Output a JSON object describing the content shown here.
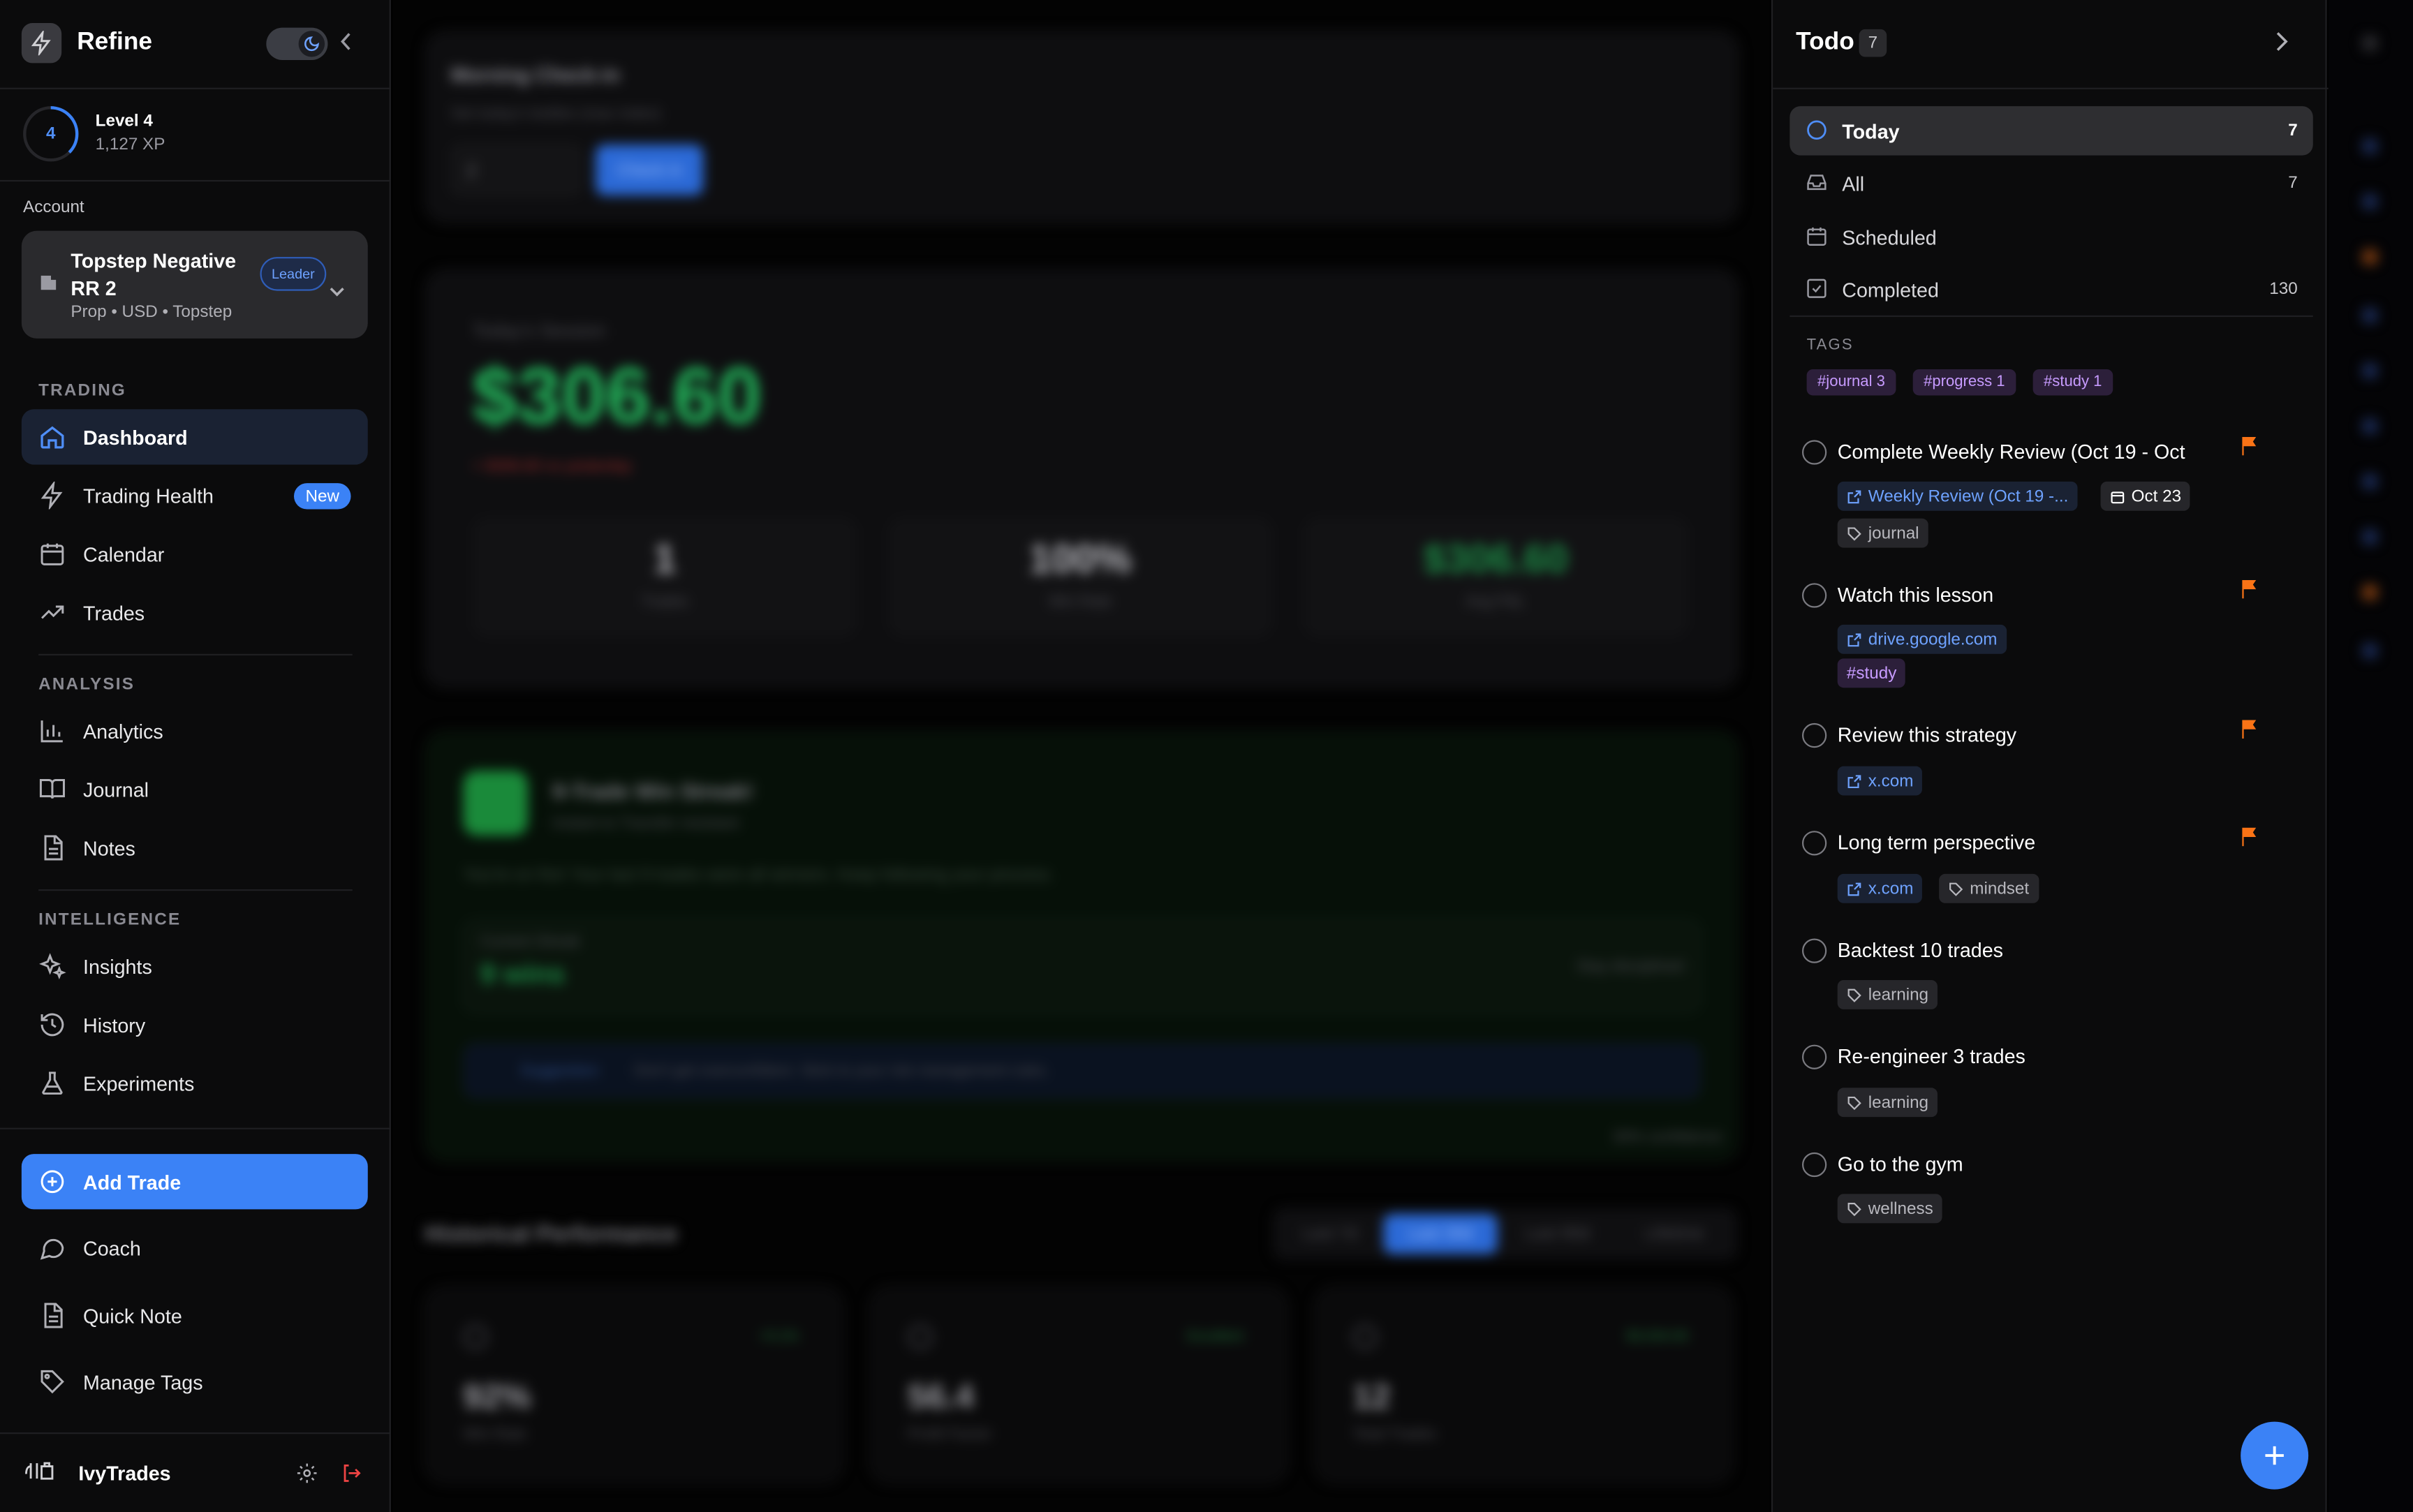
{
  "brand": {
    "name": "Refine"
  },
  "level": {
    "number": "4",
    "title": "Level 4",
    "xp": "1,127 XP"
  },
  "account": {
    "section_label": "Account",
    "name": "Topstep Negative RR 2",
    "meta": "Prop • USD • Topstep",
    "badge": "Leader"
  },
  "nav": {
    "trading_label": "TRADING",
    "analysis_label": "ANALYSIS",
    "intelligence_label": "INTELLIGENCE",
    "items": {
      "dashboard": "Dashboard",
      "trading_health": "Trading Health",
      "new_badge": "New",
      "calendar": "Calendar",
      "trades": "Trades",
      "analytics": "Analytics",
      "journal": "Journal",
      "notes": "Notes",
      "insights": "Insights",
      "history": "History",
      "experiments": "Experiments"
    },
    "add_trade": "Add Trade",
    "coach": "Coach",
    "quick_note": "Quick Note",
    "manage_tags": "Manage Tags"
  },
  "user": {
    "name": "IvyTrades"
  },
  "main": {
    "checkin_title": "Morning Check-in",
    "checkin_sub": "Set today's bottles (max index)",
    "checkin_value": "2",
    "checkin_button": "Check in",
    "session_title": "Today's Session",
    "session_pnl": "$306.60",
    "session_note": "+ $306.60 vs yesterday",
    "stats": [
      {
        "value": "1",
        "label": "Trades"
      },
      {
        "value": "100%",
        "label": "Win Rate"
      },
      {
        "value": "$306.60",
        "label": "Avg P&L"
      }
    ],
    "streak_title": "9-Trade Win Streak!",
    "streak_sub": "Instant to Transfer resistant",
    "streak_body": "You're on fire! Your last 9 trades were all winners. Keep following your process.",
    "current_streak_label": "Current Streak",
    "current_streak_value": "9 wins",
    "stay_label": "Stay disciplined",
    "suggestion_label": "Suggestion:",
    "suggestion_text": "Don't get overconfident. Stick to your risk management rules.",
    "footer_note": "30% confidence",
    "hist_title": "Historical Performance",
    "tabs": [
      "Last 7d",
      "Last 30d",
      "Last 90d",
      "Lifetime"
    ],
    "perf": [
      {
        "value": "92%",
        "label": "Win Rate",
        "tag": "+5.1%"
      },
      {
        "value": "56.4",
        "label": "Profit Factor",
        "tag": "Excellent"
      },
      {
        "value": "12",
        "label": "Total Trades",
        "tag": "$3,034.00"
      }
    ]
  },
  "todo": {
    "title": "Todo",
    "count": "7",
    "filters": [
      {
        "label": "Today",
        "count": "7"
      },
      {
        "label": "All",
        "count": "7"
      },
      {
        "label": "Scheduled",
        "count": ""
      },
      {
        "label": "Completed",
        "count": "130"
      }
    ],
    "tags_label": "TAGS",
    "tags": [
      "#journal 3",
      "#progress 1",
      "#study 1"
    ],
    "tasks": [
      {
        "title": "Complete Weekly Review (Oct 19 - Oct",
        "link": "Weekly Review (Oct 19 -...",
        "date": "Oct 23",
        "tag": "journal"
      },
      {
        "title": "Watch this lesson",
        "link": "drive.google.com",
        "tag": "#study"
      },
      {
        "title": "Review this strategy",
        "link": "x.com"
      },
      {
        "title": "Long term perspective",
        "link": "x.com",
        "tag": "mindset"
      },
      {
        "title": "Backtest 10 trades",
        "tag": "learning"
      },
      {
        "title": "Re-engineer 3 trades",
        "tag": "learning"
      },
      {
        "title": "Go to the gym",
        "tag": "wellness"
      }
    ]
  },
  "colors": {
    "accent": "#3b82f6",
    "flag": "#f97316",
    "tag_purple": "#c79bff",
    "profit_green": "#22b35a"
  }
}
